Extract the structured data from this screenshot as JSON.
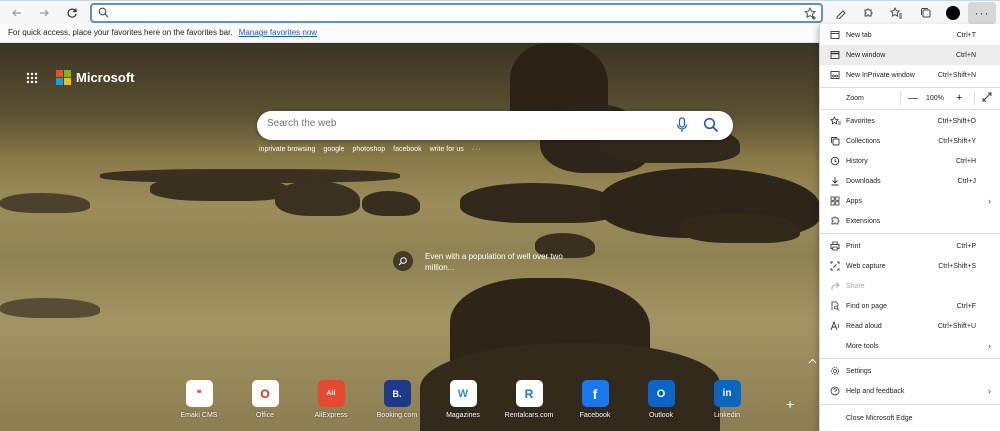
{
  "toolbar": {
    "address_value": "",
    "address_placeholder": ""
  },
  "favorites_bar": {
    "message": "For quick access, place your favorites here on the favorites bar.",
    "manage_link": "Manage favorites now"
  },
  "newtab": {
    "brand": "Microsoft",
    "search_placeholder": "Search the web",
    "suggestions": [
      "inprivate browsing",
      "google",
      "photoshop",
      "facebook",
      "write for us"
    ],
    "suggestions_more": "···",
    "caption": "Even with a population of well over two million...",
    "tiles": [
      {
        "label": "Emaki CMS",
        "icon": "emaki-icon",
        "glyph": "❝",
        "color": "#e0436b",
        "bg": "#ffffff"
      },
      {
        "label": "Office",
        "icon": "office-icon",
        "glyph": "O",
        "color": "#d83b01",
        "bg": "#ffffff"
      },
      {
        "label": "AliExpress",
        "icon": "aliexpress-icon",
        "glyph": "Ali",
        "color": "#ffffff",
        "bg": "#e8482f"
      },
      {
        "label": "Booking.com",
        "icon": "booking-icon",
        "glyph": "B.",
        "color": "#ffffff",
        "bg": "#1b3a8a"
      },
      {
        "label": "Magazines",
        "icon": "magazines-icon",
        "glyph": "W",
        "color": "#2f8de0",
        "bg": "#ffffff"
      },
      {
        "label": "Rentalcars.com",
        "icon": "rentalcars-icon",
        "glyph": "R",
        "color": "#1a76d2",
        "bg": "#ffffff"
      },
      {
        "label": "Facebook",
        "icon": "facebook-icon",
        "glyph": "f",
        "color": "#ffffff",
        "bg": "#1877f2"
      },
      {
        "label": "Outlook",
        "icon": "outlook-icon",
        "glyph": "O",
        "color": "#ffffff",
        "bg": "#0a64c9"
      },
      {
        "label": "Linkedin",
        "icon": "linkedin-icon",
        "glyph": "in",
        "color": "#ffffff",
        "bg": "#0a66c2"
      }
    ]
  },
  "menu": {
    "items": [
      {
        "label": "New tab",
        "shortcut": "Ctrl+T",
        "icon": "new-tab-icon"
      },
      {
        "label": "New window",
        "shortcut": "Ctrl+N",
        "icon": "new-window-icon"
      },
      {
        "label": "New InPrivate window",
        "shortcut": "Ctrl+Shift+N",
        "icon": "inprivate-icon"
      },
      {
        "label": "Zoom",
        "shortcut": "",
        "icon": ""
      },
      {
        "label": "Favorites",
        "shortcut": "Ctrl+Shift+O",
        "icon": "favorites-icon"
      },
      {
        "label": "Collections",
        "shortcut": "Ctrl+Shift+Y",
        "icon": "collections-icon"
      },
      {
        "label": "History",
        "shortcut": "Ctrl+H",
        "icon": "history-icon"
      },
      {
        "label": "Downloads",
        "shortcut": "Ctrl+J",
        "icon": "downloads-icon"
      },
      {
        "label": "Apps",
        "shortcut": "",
        "icon": "apps-icon"
      },
      {
        "label": "Extensions",
        "shortcut": "",
        "icon": "extensions-icon"
      },
      {
        "label": "Print",
        "shortcut": "Ctrl+P",
        "icon": "print-icon"
      },
      {
        "label": "Web capture",
        "shortcut": "Ctrl+Shift+S",
        "icon": "web-capture-icon"
      },
      {
        "label": "Share",
        "shortcut": "",
        "icon": "share-icon"
      },
      {
        "label": "Find on page",
        "shortcut": "Ctrl+F",
        "icon": "find-icon"
      },
      {
        "label": "Read aloud",
        "shortcut": "Ctrl+Shift+U",
        "icon": "read-aloud-icon"
      },
      {
        "label": "More tools",
        "shortcut": "",
        "icon": ""
      },
      {
        "label": "Settings",
        "shortcut": "",
        "icon": "settings-icon"
      },
      {
        "label": "Help and feedback",
        "shortcut": "",
        "icon": "help-icon"
      },
      {
        "label": "Close Microsoft Edge",
        "shortcut": "",
        "icon": ""
      }
    ],
    "zoom_value": "100%",
    "zoom_minus": "—",
    "zoom_plus": "+"
  },
  "colors": {
    "accent": "#5f8fc9",
    "menu_highlight": "#ececec",
    "link": "#1a5cc8"
  }
}
